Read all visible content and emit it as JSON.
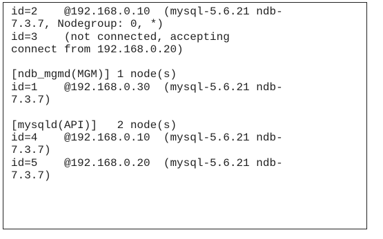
{
  "terminal": {
    "lines": [
      "id=2    @192.168.0.10  (mysql-5.6.21 ndb-",
      "7.3.7, Nodegroup: 0, *)",
      "id=3    (not connected, accepting",
      "connect from 192.168.0.20)",
      "",
      "[ndb_mgmd(MGM)] 1 node(s)",
      "id=1    @192.168.0.30  (mysql-5.6.21 ndb-",
      "7.3.7)",
      "",
      "[mysqld(API)]   2 node(s)",
      "id=4    @192.168.0.10  (mysql-5.6.21 ndb-",
      "7.3.7)",
      "id=5    @192.168.0.20  (mysql-5.6.21 ndb-",
      "7.3.7)"
    ]
  }
}
